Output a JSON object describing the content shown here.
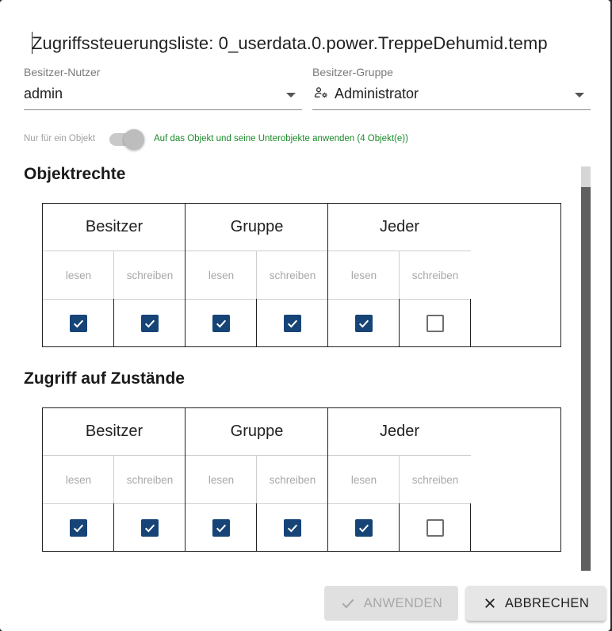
{
  "dialog": {
    "title": "Zugriffssteuerungsliste: 0_userdata.0.power.TreppeDehumid.temp"
  },
  "owner_user": {
    "label": "Besitzer-Nutzer",
    "value": "admin",
    "icon": "chevron-down-icon"
  },
  "owner_group": {
    "label": "Besitzer-Gruppe",
    "value": "Administrator",
    "icon": "group-settings-icon"
  },
  "apply_scope": {
    "off_label": "Nur für ein Objekt",
    "on_label": "Auf das Objekt und seine Unterobjekte anwenden (4 Objekt(e))",
    "checked": false
  },
  "sections": [
    {
      "title": "Objektrechte",
      "groups": [
        "Besitzer",
        "Gruppe",
        "Jeder"
      ],
      "columns": [
        "lesen",
        "schreiben",
        "lesen",
        "schreiben",
        "lesen",
        "schreiben"
      ],
      "values": [
        true,
        true,
        true,
        true,
        true,
        false
      ]
    },
    {
      "title": "Zugriff auf Zustände",
      "groups": [
        "Besitzer",
        "Gruppe",
        "Jeder"
      ],
      "columns": [
        "lesen",
        "schreiben",
        "lesen",
        "schreiben",
        "lesen",
        "schreiben"
      ],
      "values": [
        true,
        true,
        true,
        true,
        true,
        false
      ]
    }
  ],
  "buttons": {
    "apply": {
      "label": "ANWENDEN",
      "icon": "check-icon",
      "disabled": true
    },
    "cancel": {
      "label": "ABBRECHEN",
      "icon": "close-icon"
    }
  },
  "colors": {
    "checkbox_checked": "#164477",
    "scope_label": "#1b8a2a"
  }
}
